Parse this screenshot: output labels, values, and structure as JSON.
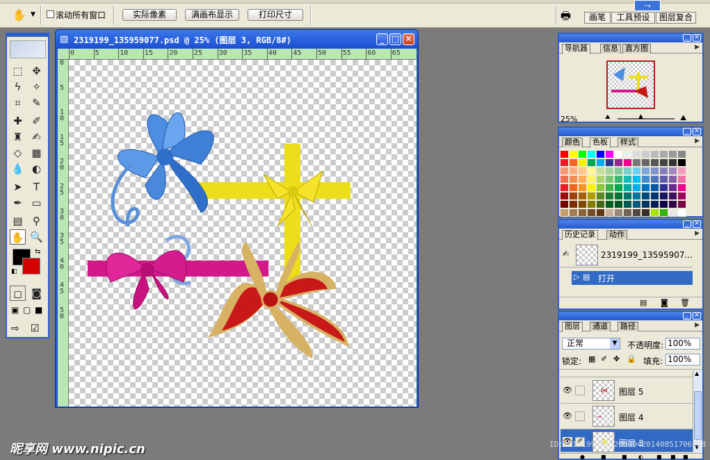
{
  "options_bar": {
    "scroll_all_label": "滚动所有窗口",
    "actual_pixels": "实际像素",
    "fit_on_screen": "满画布显示",
    "print_size": "打印尺寸",
    "palette_tabs": [
      "画笔",
      "工具预设",
      "图层复合"
    ]
  },
  "document": {
    "title": "2319199_135959077.psd @ 25% (图层 3, RGB/8#)",
    "ruler_h": [
      "0",
      "5",
      "10",
      "15",
      "20",
      "25",
      "30",
      "35",
      "40",
      "45",
      "50",
      "55",
      "60",
      "65"
    ],
    "ruler_v": [
      "0",
      "5",
      "1\n0",
      "1\n5",
      "2\n0",
      "2\n5",
      "3\n0",
      "3\n5",
      "4\n0",
      "4\n5",
      "5\n0"
    ]
  },
  "navigator": {
    "tabs": [
      "导航器",
      "信息",
      "直方图"
    ],
    "zoom": "25%"
  },
  "color_panel": {
    "tabs": [
      "颜色",
      "色板",
      "样式"
    ]
  },
  "history": {
    "tabs": [
      "历史记录",
      "动作"
    ],
    "snapshot": "2319199_13595907...",
    "step": "打开"
  },
  "layers": {
    "tabs": [
      "图层",
      "通道",
      "路径"
    ],
    "blend_mode": "正常",
    "opacity_label": "不透明度:",
    "opacity": "100%",
    "lock_label": "锁定:",
    "fill_label": "填充:",
    "fill": "100%",
    "items": [
      {
        "name": "图层 5"
      },
      {
        "name": "图层 4"
      },
      {
        "name": "图层 3"
      }
    ]
  },
  "watermark": {
    "site": "昵享网 www.nipic.cn",
    "id": "ID:2319199 NO:20090420140851706128"
  },
  "colors": {
    "foreground": "#000000",
    "background": "#d40000",
    "title_blue": "#2458cf"
  }
}
